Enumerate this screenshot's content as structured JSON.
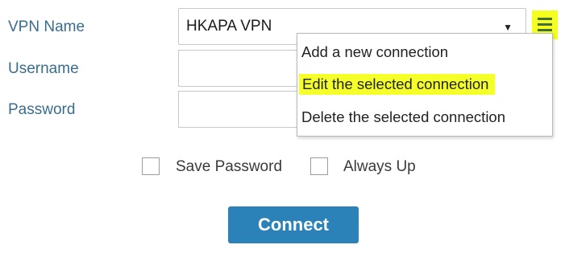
{
  "form": {
    "vpn_name_label": "VPN Name",
    "username_label": "Username",
    "password_label": "Password",
    "vpn_selected": "HKAPA VPN",
    "username_value": "",
    "password_value": ""
  },
  "menu": {
    "items": [
      {
        "label": "Add a new connection",
        "highlighted": false
      },
      {
        "label": "Edit the selected connection",
        "highlighted": true
      },
      {
        "label": "Delete the selected connection",
        "highlighted": false
      }
    ]
  },
  "options": {
    "save_password_label": "Save Password",
    "always_up_label": "Always Up"
  },
  "actions": {
    "connect_label": "Connect"
  },
  "colors": {
    "label_text": "#3a6d8c",
    "highlight": "#f5ff28",
    "connect_bg": "#2a82b8",
    "menu_icon_bars": "#3f6e3a"
  }
}
